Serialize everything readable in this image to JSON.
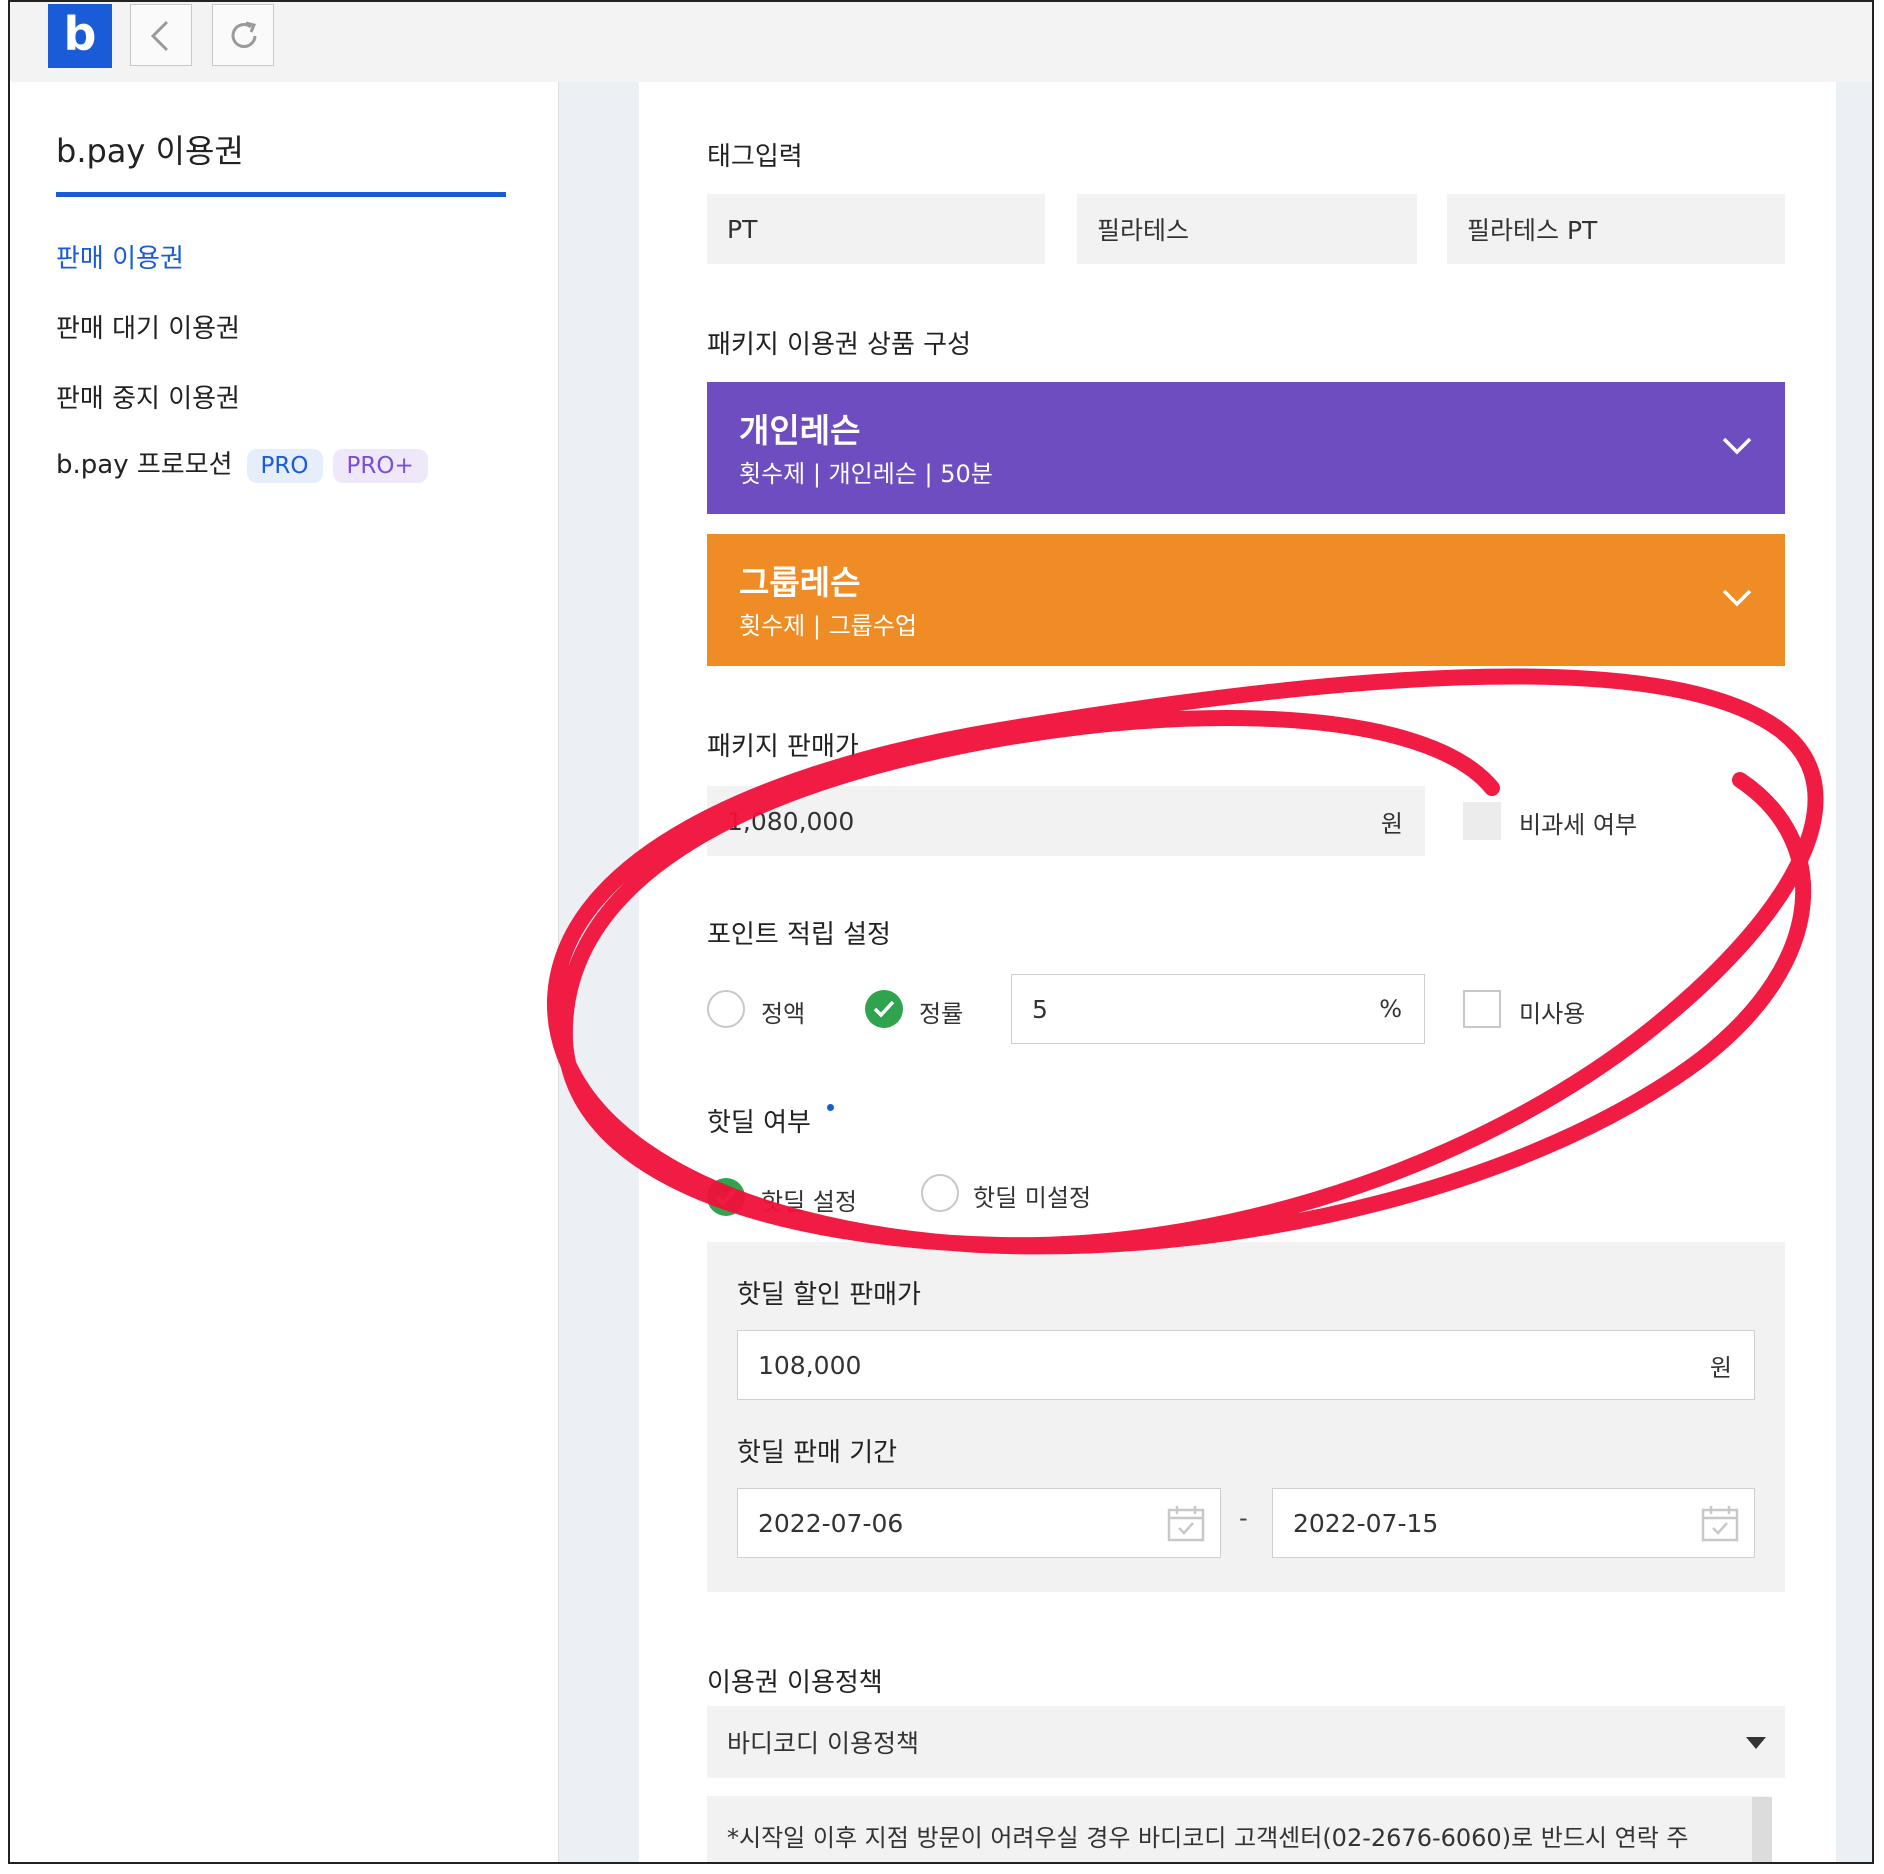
{
  "sidebar": {
    "title": "b.pay 이용권",
    "items": [
      {
        "label": "판매 이용권"
      },
      {
        "label": "판매 대기 이용권"
      },
      {
        "label": "판매 중지 이용권"
      },
      {
        "label": "b.pay 프로모션"
      }
    ],
    "badges": [
      "PRO",
      "PRO+"
    ]
  },
  "topbar": {
    "logo": "b"
  },
  "tags": {
    "label": "태그입력",
    "values": [
      "PT",
      "필라테스",
      "필라테스 PT"
    ]
  },
  "package": {
    "label": "패키지 이용권 상품 구성",
    "items": [
      {
        "title": "개인레슨",
        "sub": "횟수제 | 개인레슨 | 50분",
        "color": "#6d4dbf"
      },
      {
        "title": "그룹레슨",
        "sub": "횟수제 | 그룹수업",
        "color": "#ef8c25"
      }
    ]
  },
  "price": {
    "label": "패키지 판매가",
    "value": "1,080,000",
    "unit": "원",
    "taxfree_label": "비과세 여부"
  },
  "points": {
    "label": "포인트 적립 설정",
    "option_fixed": "정액",
    "option_rate": "정률",
    "rate_value": "5",
    "rate_unit": "%",
    "unused_label": "미사용"
  },
  "hotdeal": {
    "label": "핫딜 여부",
    "option_set": "핫딜 설정",
    "option_unset": "핫딜 미설정",
    "discount_label": "핫딜 할인 판매가",
    "discount_value": "108,000",
    "discount_unit": "원",
    "period_label": "핫딜 판매 기간",
    "start": "2022-07-06",
    "separator": "-",
    "end": "2022-07-15"
  },
  "policy": {
    "label": "이용권 이용정책",
    "selected": "바디코디 이용정책",
    "notice": "*시작일 이후 지점 방문이 어려우실 경우 바디코디 고객센터(02-2676-6060)로 반드시 연락 주"
  },
  "colors": {
    "accent": "#1a5bd8",
    "check": "#2fa34d",
    "annotation": "#f0103a"
  }
}
